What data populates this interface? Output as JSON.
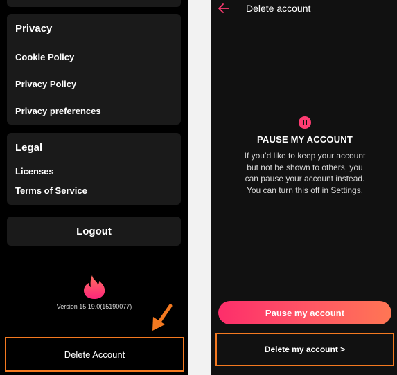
{
  "left_screen": {
    "privacy_section": {
      "title": "Privacy",
      "items": [
        "Cookie Policy",
        "Privacy Policy",
        "Privacy preferences"
      ]
    },
    "legal_section": {
      "title": "Legal",
      "items": [
        "Licenses",
        "Terms of Service"
      ]
    },
    "logout_label": "Logout",
    "logo_icon": "tinder-flame-icon",
    "version_text": "Version 15.19.0(15190077)",
    "delete_account_label": "Delete Account"
  },
  "right_screen": {
    "header_title": "Delete account",
    "back_icon": "back-arrow-icon",
    "pause_icon": "pause-icon",
    "pause_heading": "PAUSE MY ACCOUNT",
    "pause_description": "If you’d like to keep your account but not be shown to others, you can pause your account instead. You can turn this off in Settings.",
    "pause_button_label": "Pause my account",
    "delete_button_label": "Delete my account >"
  },
  "colors": {
    "brand_pink": "#fe3c72",
    "highlight_orange": "#f47920",
    "background_dark": "#111111"
  }
}
